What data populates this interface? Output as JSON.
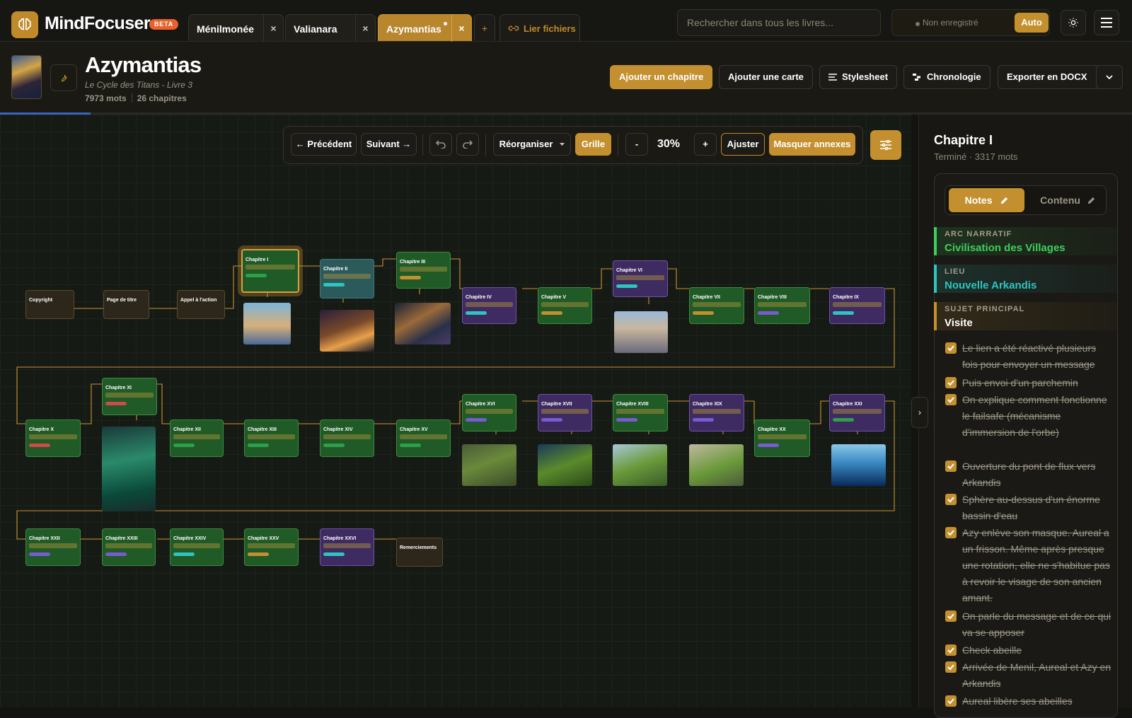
{
  "app": {
    "name": "MindFocuser",
    "beta_badge": "BETA",
    "tabs": [
      {
        "label": "Ménilmonée",
        "close": "×"
      },
      {
        "label": "Valianara",
        "close": "×"
      },
      {
        "label": "Azymantias",
        "close": "×",
        "active": true,
        "unsaved": true
      }
    ],
    "add_tab": "+",
    "link_files": "Lier fichiers",
    "search_placeholder": "Rechercher dans tous les livres...",
    "save_status": "Non enregistré",
    "auto_label": "Auto",
    "icons": {
      "theme": "sun-icon",
      "menu": "hamburger-icon",
      "logo": "brain-icon"
    },
    "colors": {
      "accent": "#c4902f",
      "beta": "#e8622a",
      "progress": "#3b62c2"
    }
  },
  "book": {
    "title": "Azymantias",
    "subtitle": "Le Cycle des Titans - Livre 3",
    "words": "7973 mots",
    "chapters": "26 chapitres",
    "progress_fraction": 0.08,
    "actions": {
      "add_chapter": "Ajouter un chapitre",
      "add_card": "Ajouter une carte",
      "stylesheet": "Stylesheet",
      "timeline": "Chronologie",
      "export": "Exporter en DOCX"
    }
  },
  "toolbar": {
    "prev": "← Précédent",
    "next": "Suivant →",
    "reorganize": "Réorganiser",
    "grid": "Grille",
    "zoom_out": "-",
    "zoom": "30%",
    "zoom_in": "+",
    "fit": "Ajuster",
    "hide_annexes": "Masquer annexes"
  },
  "board": {
    "row1": [
      {
        "id": "copyright",
        "title": "Copyright",
        "kind": "brown"
      },
      {
        "id": "title-page",
        "title": "Page de titre",
        "kind": "brown"
      },
      {
        "id": "call",
        "title": "Appel à l'action",
        "kind": "brown"
      },
      {
        "id": "c1",
        "title": "Chapitre I",
        "kind": "green",
        "selected": true
      },
      {
        "id": "c2",
        "title": "Chapitre II",
        "kind": "teal"
      },
      {
        "id": "c3",
        "title": "Chapitre III",
        "kind": "green"
      },
      {
        "id": "c4",
        "title": "Chapitre IV",
        "kind": "purple"
      },
      {
        "id": "c5",
        "title": "Chapitre V",
        "kind": "green"
      },
      {
        "id": "c6",
        "title": "Chapitre VI",
        "kind": "purple"
      },
      {
        "id": "c7",
        "title": "Chapitre VII",
        "kind": "green"
      },
      {
        "id": "c8",
        "title": "Chapitre VIII",
        "kind": "green"
      },
      {
        "id": "c9",
        "title": "Chapitre IX",
        "kind": "purple"
      }
    ],
    "row2": [
      {
        "id": "c10",
        "title": "Chapitre X",
        "kind": "green"
      },
      {
        "id": "c11",
        "title": "Chapitre XI",
        "kind": "green"
      },
      {
        "id": "c12",
        "title": "Chapitre XII",
        "kind": "green"
      },
      {
        "id": "c13",
        "title": "Chapitre XIII",
        "kind": "green"
      },
      {
        "id": "c14",
        "title": "Chapitre XIV",
        "kind": "green"
      },
      {
        "id": "c15",
        "title": "Chapitre XV",
        "kind": "green"
      },
      {
        "id": "c16",
        "title": "Chapitre XVI",
        "kind": "green"
      },
      {
        "id": "c17",
        "title": "Chapitre XVII",
        "kind": "purple"
      },
      {
        "id": "c18",
        "title": "Chapitre XVIII",
        "kind": "green"
      },
      {
        "id": "c19",
        "title": "Chapitre XIX",
        "kind": "purple"
      },
      {
        "id": "c20",
        "title": "Chapitre XX",
        "kind": "green"
      },
      {
        "id": "c21",
        "title": "Chapitre XXI",
        "kind": "purple"
      }
    ],
    "row3": [
      {
        "id": "c22",
        "title": "Chapitre XXII",
        "kind": "green"
      },
      {
        "id": "c23",
        "title": "Chapitre XXIII",
        "kind": "green"
      },
      {
        "id": "c24",
        "title": "Chapitre XXIV",
        "kind": "green"
      },
      {
        "id": "c25",
        "title": "Chapitre XXV",
        "kind": "green"
      },
      {
        "id": "c26",
        "title": "Chapitre XXVI",
        "kind": "purple"
      },
      {
        "id": "thanks",
        "title": "Remerciements",
        "kind": "brown"
      }
    ]
  },
  "panel": {
    "title": "Chapitre I",
    "subtitle": "Terminé · 3317 mots",
    "tab_notes": "Notes",
    "tab_content": "Contenu",
    "meta": [
      {
        "key": "ARC NARRATIF",
        "value": "Civilisation des Villages",
        "color": "#3ecf5a"
      },
      {
        "key": "LIEU",
        "value": "Nouvelle Arkandis",
        "color": "#2ec4c0"
      },
      {
        "key": "SUJET PRINCIPAL",
        "value": "Visite",
        "color": "#c4902f"
      }
    ],
    "notes": [
      "Le lien a été réactivé plusieurs fois pour envoyer un message",
      "Puis envoi d'un parchemin",
      "On explique comment fonctionne le failsafe (mécanisme d'immersion de l'orbe)",
      "Ouverture du pont de flux vers Arkandis",
      "Sphère au-dessus d'un énorme bassin d'eau",
      "Azy enlève son masque. Aureal a un frisson. Même après presque une rotation, elle ne s'habitue pas à revoir le visage de son ancien amant.",
      "On parle du message et de ce qui va se apposer",
      "Check abeille",
      "Arrivée de Menil, Aureal et Azy en Arkandis",
      "Aureal libère ses abeilles"
    ],
    "collapse": "›"
  }
}
